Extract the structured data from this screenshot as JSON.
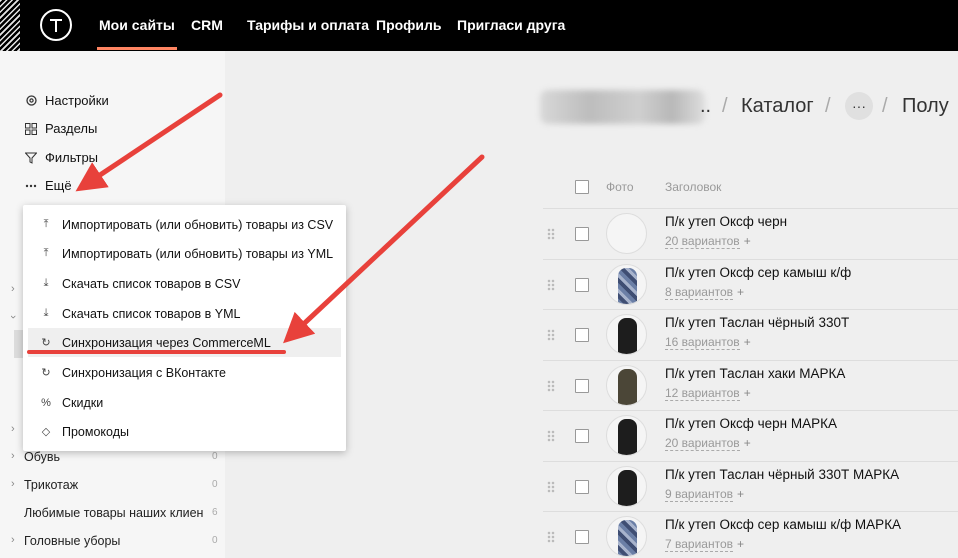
{
  "topbar": {
    "nav": [
      "Мои сайты",
      "CRM",
      "Тарифы и оплата",
      "Профиль",
      "Пригласи друга"
    ]
  },
  "sidebar": {
    "links": [
      {
        "label": "Настройки",
        "icon": "gear-icon"
      },
      {
        "label": "Разделы",
        "icon": "grid-icon"
      },
      {
        "label": "Фильтры",
        "icon": "filter-icon"
      },
      {
        "label": "Ещё",
        "icon": "ellipsis-icon"
      }
    ],
    "categories": [
      {
        "name": "Обувь",
        "count": "0"
      },
      {
        "name": "Трикотаж",
        "count": "0"
      },
      {
        "name": "Любимые товары наших клиен",
        "count": "6"
      },
      {
        "name": "Головные уборы",
        "count": "0"
      }
    ]
  },
  "dropdown": {
    "items": [
      {
        "label": "Импортировать (или обновить) товары из CSV",
        "icon": "upload-icon"
      },
      {
        "label": "Импортировать (или обновить) товары из YML",
        "icon": "upload-icon"
      },
      {
        "label": "Скачать список товаров в CSV",
        "icon": "download-icon"
      },
      {
        "label": "Скачать список товаров в YML",
        "icon": "download-icon"
      },
      {
        "label": "Синхронизация через CommerceML",
        "icon": "sync-icon"
      },
      {
        "label": "Синхронизация с ВКонтакте",
        "icon": "sync-icon"
      },
      {
        "label": "Скидки",
        "icon": "percent-icon"
      },
      {
        "label": "Промокоды",
        "icon": "tag-icon"
      }
    ]
  },
  "breadcrumb": {
    "ellipsis": "..",
    "sep": "/",
    "catalog": "Каталог",
    "more": "···",
    "tail": "Полу"
  },
  "table": {
    "headers": {
      "photo": "Фото",
      "title": "Заголовок"
    },
    "plus": "+",
    "rows": [
      {
        "title": "П/к утеп Оксф черн",
        "variants": "20 вариантов",
        "thumb": "none"
      },
      {
        "title": "П/к утеп Оксф сер камыш к/ф",
        "variants": "8 вариантов",
        "thumb": "camo"
      },
      {
        "title": "П/к утеп Таслан чёрный 330Т",
        "variants": "16 вариантов",
        "thumb": "black"
      },
      {
        "title": "П/к утеп Таслан хаки МАРКА",
        "variants": "12 вариантов",
        "thumb": "khaki"
      },
      {
        "title": "П/к утеп Оксф черн МАРКА",
        "variants": "20 вариантов",
        "thumb": "black"
      },
      {
        "title": "П/к утеп Таслан чёрный 330Т МАРКА",
        "variants": "9 вариантов",
        "thumb": "black"
      },
      {
        "title": "П/к утеп Оксф сер камыш к/ф МАРКА",
        "variants": "7 вариантов",
        "thumb": "camo"
      }
    ]
  },
  "colors": {
    "accent": "#ff8562",
    "arrow": "#e8413b"
  }
}
